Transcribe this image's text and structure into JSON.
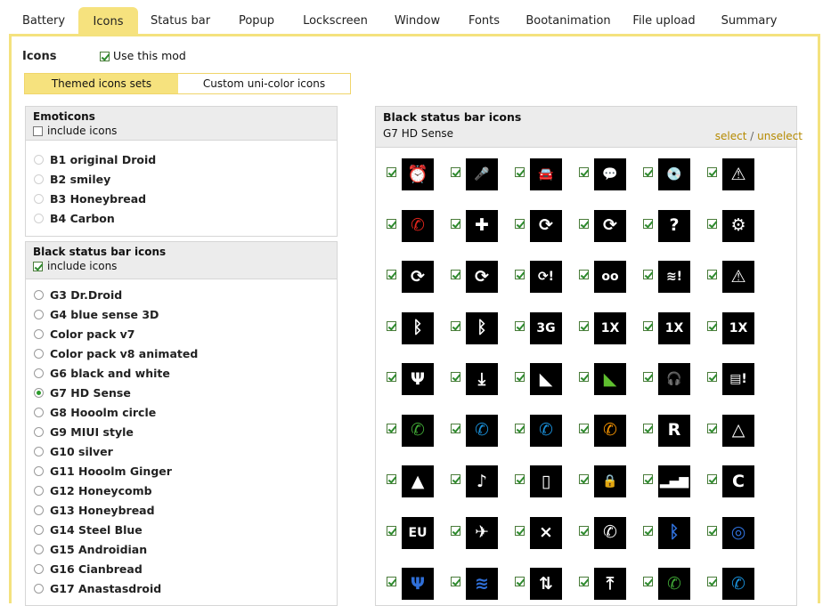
{
  "tabs": [
    "Battery",
    "Icons",
    "Status bar",
    "Popup",
    "Lockscreen",
    "Window",
    "Fonts",
    "Bootanimation",
    "File upload",
    "Summary"
  ],
  "active_tab": "Icons",
  "section": {
    "title": "Icons",
    "use_mod_label": "Use this mod"
  },
  "subtabs": [
    "Themed icons sets",
    "Custom uni-color icons"
  ],
  "emoticons": {
    "title": "Emoticons",
    "include_label": "include icons",
    "options": [
      "B1 original Droid",
      "B2 smiley",
      "B3 Honeybread",
      "B4 Carbon"
    ]
  },
  "black_icons": {
    "title": "Black status bar icons",
    "include_label": "include icons",
    "options": [
      "G3 Dr.Droid",
      "G4 blue sense 3D",
      "Color pack v7",
      "Color pack v8 animated",
      "G6 black and white",
      "G7 HD Sense",
      "G8 Hooolm circle",
      "G9 MIUI style",
      "G10 silver",
      "G11 Hooolm Ginger",
      "G12 Honeycomb",
      "G13 Honeybread",
      "G14 Steel Blue",
      "G15 Androidian",
      "G16 Cianbread",
      "G17 Anastasdroid"
    ],
    "selected": "G7 HD Sense"
  },
  "preview": {
    "title": "Black status bar icons",
    "set_name": "G7 HD Sense",
    "select_label": "select",
    "separator": "/",
    "unselect_label": "unselect",
    "icon_rows": [
      [
        "alarm-icon",
        "microphone-icon",
        "car-icon",
        "message-icon",
        "disc-alert-icon",
        "warning-icon"
      ],
      [
        "missed-call-icon",
        "sd-delete-icon",
        "sd-sync-icon",
        "sd-sync-icon",
        "sd-unknown-icon",
        "sd-settings-icon"
      ],
      [
        "sync-icon",
        "sync-icon",
        "sync-error-icon",
        "voicemail-icon",
        "wifi-alert-icon",
        "warning-icon"
      ],
      [
        "bluetooth-icon",
        "bluetooth-connected-icon",
        "signal-3g-icon",
        "signal-1x-icon",
        "signal-1x-active-icon",
        "signal-1x-up-icon"
      ],
      [
        "usb-icon",
        "download-icon",
        "satellite-icon",
        "satellite-green-icon",
        "headphones-icon",
        "sd-alert-icon"
      ],
      [
        "phone-green-icon",
        "phone-blue-icon",
        "phone-forward-icon",
        "phone-hold-icon",
        "signal-roaming-icon",
        "signal-alert-icon"
      ],
      [
        "signal-warning-icon",
        "mute-icon",
        "vibrate-icon",
        "lock-icon",
        "signal-bars-icon",
        "signal-c-icon"
      ],
      [
        "signal-eu-icon",
        "airplane-icon",
        "no-signal-icon",
        "call-active-icon",
        "bluetooth-circle-icon",
        "circle-blue-icon"
      ],
      [
        "usb-blue-icon",
        "wifi-blue-icon",
        "upload-down-icon",
        "upload-icon",
        "phone-lock-icon",
        "phone-blue-icon"
      ]
    ],
    "glyphs": {
      "alarm-icon": "⏰",
      "microphone-icon": "🎤",
      "car-icon": "🚘",
      "message-icon": "💬",
      "disc-alert-icon": "💿",
      "warning-icon": "⚠",
      "missed-call-icon": "✆",
      "sd-delete-icon": "✚",
      "sd-sync-icon": "⟳",
      "sd-unknown-icon": "?",
      "sd-settings-icon": "⚙",
      "sync-icon": "⟳",
      "sync-error-icon": "⟳!",
      "voicemail-icon": "ᴏᴏ",
      "wifi-alert-icon": "≋!",
      "bluetooth-icon": "ᛒ",
      "bluetooth-connected-icon": "ᛒ",
      "signal-3g-icon": "3G",
      "signal-1x-icon": "1X",
      "signal-1x-active-icon": "1X",
      "signal-1x-up-icon": "1X",
      "usb-icon": "Ψ",
      "download-icon": "⤓",
      "satellite-icon": "◣",
      "satellite-green-icon": "◣",
      "headphones-icon": "🎧",
      "sd-alert-icon": "▤!",
      "phone-green-icon": "✆",
      "phone-blue-icon": "✆",
      "phone-forward-icon": "✆",
      "phone-hold-icon": "✆",
      "signal-roaming-icon": "R",
      "signal-alert-icon": "△",
      "signal-warning-icon": "▲",
      "mute-icon": "♪",
      "vibrate-icon": "▯",
      "lock-icon": "🔒",
      "signal-bars-icon": "▂▄▆",
      "signal-c-icon": "C",
      "signal-eu-icon": "EU",
      "airplane-icon": "✈",
      "no-signal-icon": "×",
      "call-active-icon": "✆",
      "bluetooth-circle-icon": "ᛒ",
      "circle-blue-icon": "◎",
      "usb-blue-icon": "Ψ",
      "wifi-blue-icon": "≋",
      "upload-down-icon": "⇅",
      "upload-icon": "⤒",
      "phone-lock-icon": "✆"
    },
    "glyph_colors": {
      "phone-green-icon": "#3fa535",
      "phone-blue-icon": "#1a8fd8",
      "phone-forward-icon": "#1a8fd8",
      "phone-hold-icon": "#f39200",
      "satellite-green-icon": "#5fbf2f",
      "missed-call-icon": "#e0241b",
      "bluetooth-circle-icon": "#2f6fd8",
      "circle-blue-icon": "#2f6fd8",
      "usb-blue-icon": "#2f6fd8",
      "wifi-blue-icon": "#2f6fd8",
      "phone-lock-icon": "#3fa535"
    }
  },
  "colors": {
    "accent": "#f6e27e",
    "accent_border": "#f0d56a",
    "check": "#2d8a2d",
    "link": "#b58a00"
  }
}
